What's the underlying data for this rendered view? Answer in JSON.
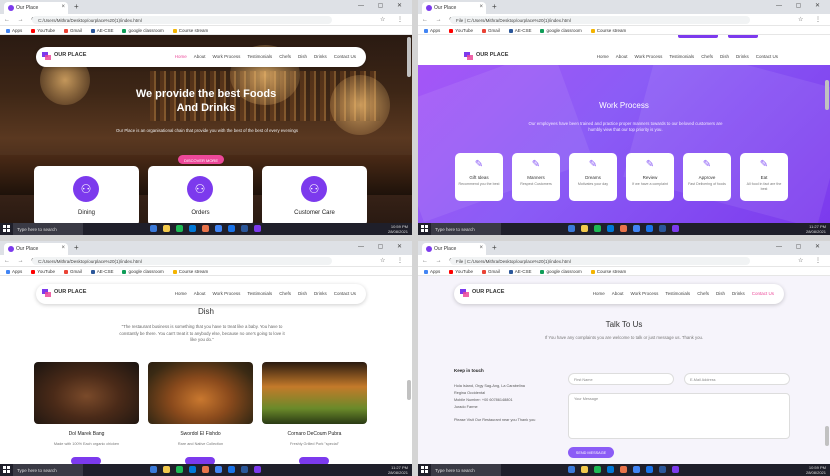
{
  "browser": {
    "tab_title": "Our Place",
    "new_tab": "+",
    "window_controls": "— ▢ ✕",
    "nav_buttons": "← → ⟳",
    "url_a": "C:/Users/Mithra/Desktop/ourplace%20(1)/index.html",
    "url_b": "File | C:/Users/Mithra/Desktop/ourplace%20(1)/index.html",
    "addr_icons": "☆ ⋮",
    "bookmarks": [
      "Apps",
      "YouTube",
      "Gmail",
      "AE-CSE",
      "google classroom",
      "Course stream"
    ],
    "bookmark_colors": [
      "#4285f4",
      "#ff0000",
      "#ea4335",
      "#2b579a",
      "#0f9d58",
      "#f4b400"
    ]
  },
  "taskbar": {
    "search": "Type here to search",
    "app_colors": [
      "#3b7ad9",
      "#f2c94c",
      "#1db954",
      "#0078d7",
      "#e8734a",
      "#4285f4",
      "#1a73e8",
      "#2b579a",
      "#7c3aed"
    ],
    "tray_lang": "ENG",
    "time_a": "10:59 PM",
    "date_a": "28/08/2021",
    "time_b": "11:27 PM",
    "date_b": "28/08/2021"
  },
  "site": {
    "logo": "OUR PLACE",
    "menu": [
      "Home",
      "About",
      "Work Process",
      "Testimonials",
      "Chefs",
      "Dish",
      "Drinks",
      "Contact Us"
    ],
    "colors": {
      "primary": "#7c3aed",
      "accent": "#ec4899"
    }
  },
  "hero": {
    "title_line1": "We provide the best Foods",
    "title_line2": "And Drinks",
    "subtitle": "Our Place is an organisational chain that provide you with the best of the best of every evenings",
    "button": "DISCOVER MORE",
    "services": [
      {
        "label": "Dining",
        "icon": "dining-icon"
      },
      {
        "label": "Orders",
        "icon": "orders-icon"
      },
      {
        "label": "Customer Care",
        "icon": "customer-care-icon"
      }
    ]
  },
  "work_process": {
    "title": "Work Process",
    "subtitle": "Our employees have been trained and practice proper manners towards to our beloved customers are humbly view that our top priority is you.",
    "steps": [
      {
        "title": "Gift Ideas",
        "desc": "Recommend you the best"
      },
      {
        "title": "Manners",
        "desc": "Respect Customers"
      },
      {
        "title": "Dreams",
        "desc": "Motivates your day"
      },
      {
        "title": "Review",
        "desc": "If we have a complaint"
      },
      {
        "title": "Approve",
        "desc": "Fast Delivering of foods"
      },
      {
        "title": "Eat",
        "desc": "All food in fact are the best"
      }
    ]
  },
  "dish": {
    "title": "Dish",
    "quote": "\"The restaurant business is something that you have to treat like a baby. You have to constantly be there. You can't treat it to anybody else, because no one's going to love it like you do.\"",
    "items": [
      {
        "name": "Dol Marek Bang",
        "desc": "Made with 100% Each organic chicken"
      },
      {
        "name": "Swordol El Fishdo",
        "desc": "Rare and Native Collection"
      },
      {
        "name": "Cornaro DeCoum Pubra",
        "desc": "Freshly Grilled Pork \"special\""
      }
    ]
  },
  "contact": {
    "title": "Talk To Us",
    "subtitle": "If You have any complaints you are welcome to talk or just message us. Thank you.",
    "keep_title": "Keep in touch",
    "address_lines": [
      "Hola Island, Orgy Sag-Ang, La Carabelina",
      "Regina Occidental",
      "Mobile Number: +00 60786148801",
      "Jurado Farme"
    ],
    "note": "Please Visit Our Restaurant near you Thank you",
    "first_name": "First Name",
    "email": "E-Mail Address",
    "message": "Your Message",
    "send": "SEND MESSAGE"
  }
}
